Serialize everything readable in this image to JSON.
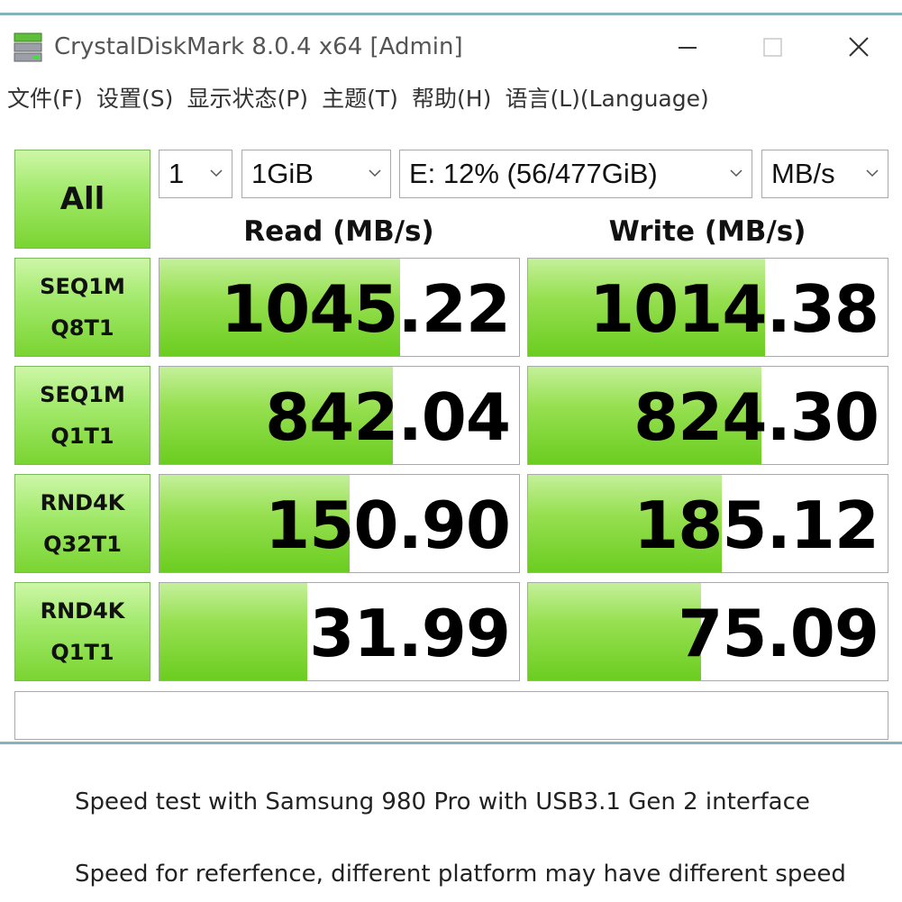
{
  "window": {
    "title": "CrystalDiskMark 8.0.4 x64 [Admin]",
    "accent_color": "#7fb4c0"
  },
  "menu": [
    "文件(F)",
    "设置(S)",
    "显示状态(P)",
    "主题(T)",
    "帮助(H)",
    "语言(L)(Language)"
  ],
  "controls": {
    "all_label": "All",
    "count": "1",
    "size": "1GiB",
    "drive": "E: 12% (56/477GiB)",
    "unit": "MB/s"
  },
  "headers": {
    "read": "Read (MB/s)",
    "write": "Write (MB/s)"
  },
  "tests": [
    {
      "line1": "SEQ1M",
      "line2": "Q8T1",
      "read": "1045.22",
      "write": "1014.38",
      "read_fill": 0.67,
      "write_fill": 0.66
    },
    {
      "line1": "SEQ1M",
      "line2": "Q1T1",
      "read": "842.04",
      "write": "824.30",
      "read_fill": 0.65,
      "write_fill": 0.65
    },
    {
      "line1": "RND4K",
      "line2": "Q32T1",
      "read": "150.90",
      "write": "185.12",
      "read_fill": 0.53,
      "write_fill": 0.54
    },
    {
      "line1": "RND4K",
      "line2": "Q1T1",
      "read": "31.99",
      "write": "75.09",
      "read_fill": 0.41,
      "write_fill": 0.48
    }
  ],
  "status_text": "",
  "captions": [
    "Speed test with Samsung 980 Pro with USB3.1 Gen 2 interface",
    "Speed for referfence, different platform may have different speed"
  ],
  "colors": {
    "button_green": "#7ad431",
    "bar_green": "#6bcd1f"
  }
}
